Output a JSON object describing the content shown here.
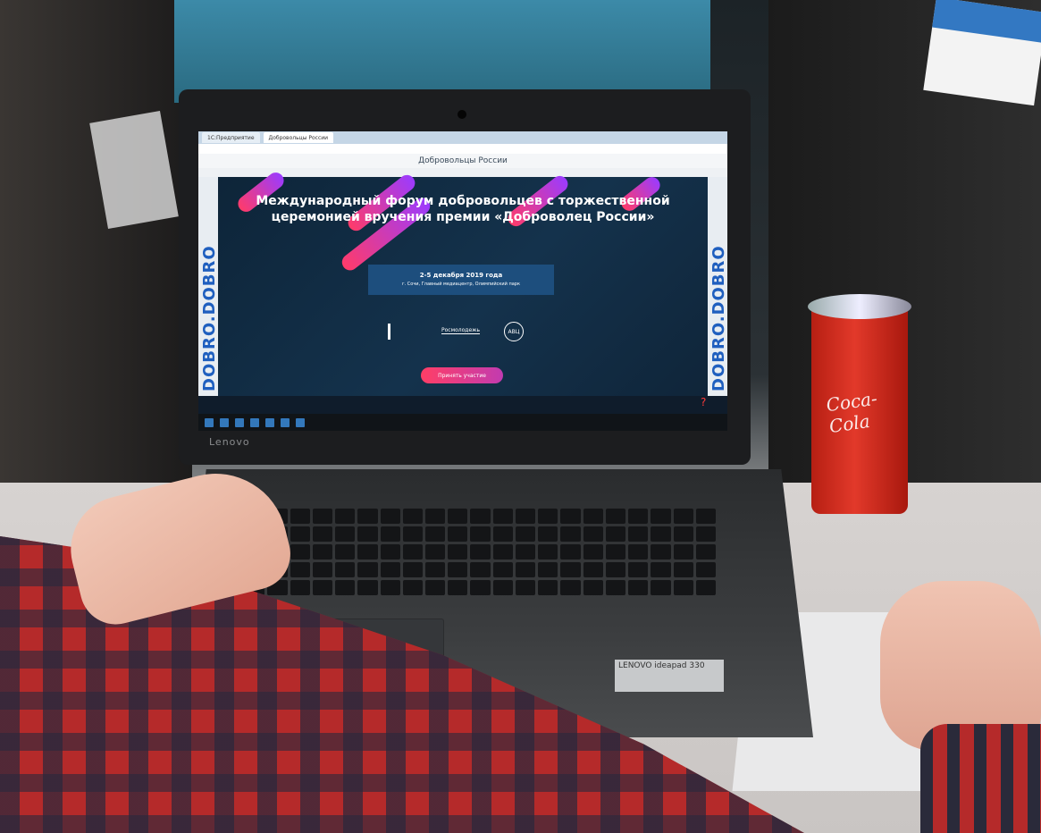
{
  "laptop": {
    "brand": "Lenovo",
    "model_sticker": "LENOVO ideapad 330"
  },
  "browser": {
    "tabs": [
      "1С:Предприятие",
      "Добровольцы России"
    ],
    "site_title": "Добровольцы России"
  },
  "page": {
    "side_text_left": "DOBRO.DOBRO",
    "side_text_right": "DOBRO.DOBRO",
    "hero_title": "Международный форум добровольцев с торжественной церемонией вручения премии «Доброволец России»",
    "date": "2-5 декабря 2019 года",
    "location": "г. Сочи, Главный медиацентр, Олимпийский парк",
    "partners": [
      "Росмолодежь",
      "АВЦ"
    ],
    "cta_label": "Принять участие",
    "help_mark": "?"
  },
  "background": {
    "can_label": "Coca-Cola"
  }
}
